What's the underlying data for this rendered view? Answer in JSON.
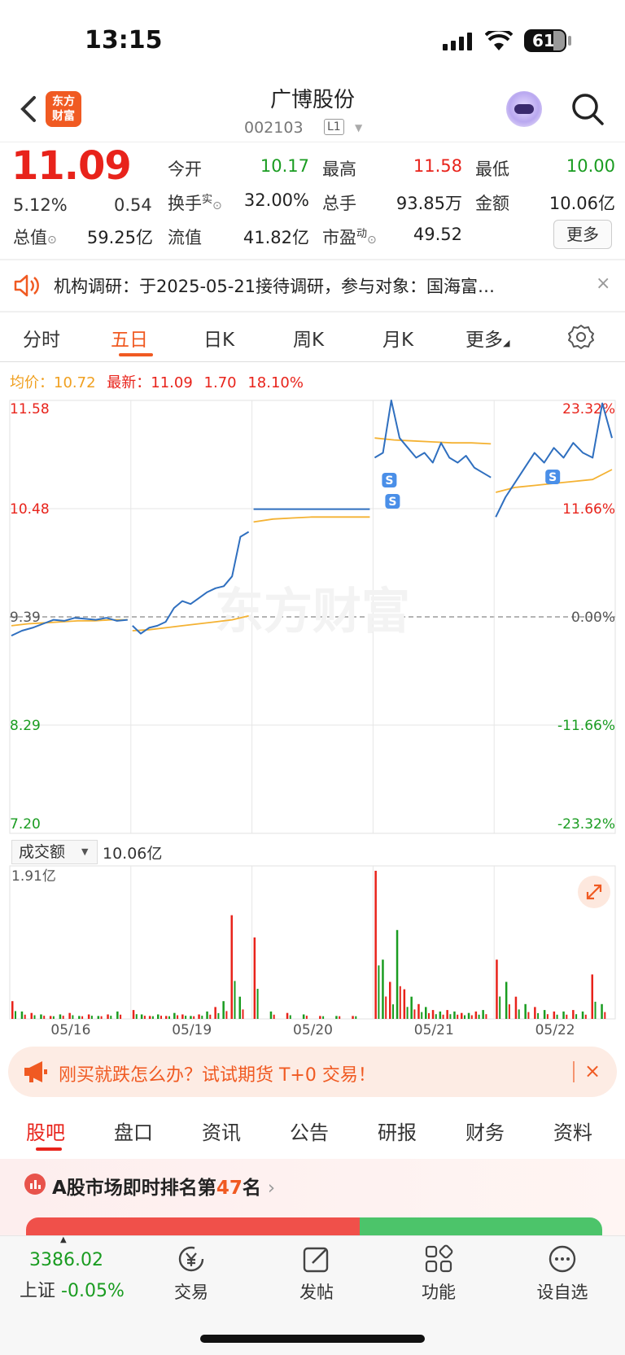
{
  "status_bar": {
    "time": "13:15",
    "battery": "61"
  },
  "header": {
    "title": "广博股份",
    "code": "002103",
    "level": "L1",
    "logo_text_1": "东方",
    "logo_text_2": "财富"
  },
  "quote": {
    "price": "11.09",
    "change_pct": "5.12%",
    "change": "0.54",
    "fields": [
      {
        "label": "今开",
        "value": "10.17",
        "color": "green"
      },
      {
        "label": "最高",
        "value": "11.58",
        "color": "red"
      },
      {
        "label": "最低",
        "value": "10.00",
        "color": "green"
      },
      {
        "label": "换手",
        "sup": "实",
        "value": "32.00%"
      },
      {
        "label": "总手",
        "value": "93.85万"
      },
      {
        "label": "金额",
        "value": "10.06亿"
      },
      {
        "label": "总值",
        "value": "59.25亿"
      },
      {
        "label": "流值",
        "value": "41.82亿"
      },
      {
        "label": "市盈",
        "sup": "动",
        "value": "49.52"
      }
    ],
    "more_label": "更多"
  },
  "notice": {
    "text": "机构调研：于2025-05-21接待调研，参与对象：国海富…",
    "close": "×"
  },
  "chart_tabs": [
    "分时",
    "五日",
    "日K",
    "周K",
    "月K",
    "更多"
  ],
  "avg_info": {
    "avg_label": "均价：",
    "avg_value": "10.72",
    "latest_label": "最新：",
    "latest_value": "11.09",
    "chg": "1.70",
    "chg_pct": "18.10%"
  },
  "chart_data": {
    "type": "line",
    "ylabels_left": [
      "11.58",
      "10.48",
      "9.39",
      "8.29",
      "7.20"
    ],
    "ylabels_right": [
      "23.32%",
      "11.66%",
      "0.00%",
      "-11.66%",
      "-23.32%"
    ],
    "ylim": [
      7.2,
      11.58
    ],
    "days": [
      "05/16",
      "05/19",
      "05/20",
      "05/21",
      "05/22"
    ],
    "series": [
      {
        "name": "最新",
        "color": "#2f6fbf",
        "days": [
          [
            9.2,
            9.25,
            9.28,
            9.32,
            9.36,
            9.35,
            9.38,
            9.37,
            9.36,
            9.38,
            9.35,
            9.36
          ],
          [
            9.3,
            9.22,
            9.28,
            9.3,
            9.34,
            9.48,
            9.55,
            9.52,
            9.58,
            9.64,
            9.68,
            9.7,
            9.8,
            10.2,
            10.25
          ],
          [
            10.48,
            10.48,
            10.48,
            10.48,
            10.48,
            10.48,
            10.48
          ],
          [
            11.0,
            11.05,
            11.58,
            11.2,
            11.1,
            11.0,
            11.05,
            10.95,
            11.15,
            11.0,
            10.95,
            11.02,
            10.9,
            10.85,
            10.8
          ],
          [
            10.4,
            10.6,
            10.75,
            10.9,
            11.05,
            10.95,
            11.1,
            11.0,
            11.15,
            11.05,
            11.0,
            11.55,
            11.2
          ]
        ]
      },
      {
        "name": "均价",
        "color": "#f4b233",
        "days": [
          [
            9.3,
            9.32,
            9.33,
            9.34,
            9.35,
            9.35,
            9.36,
            9.36
          ],
          [
            9.25,
            9.26,
            9.28,
            9.3,
            9.32,
            9.34,
            9.36,
            9.4
          ],
          [
            10.35,
            10.38,
            10.39,
            10.4,
            10.4,
            10.4,
            10.4
          ],
          [
            11.2,
            11.18,
            11.17,
            11.16,
            11.15,
            11.15,
            11.14
          ],
          [
            10.65,
            10.7,
            10.72,
            10.74,
            10.76,
            10.78,
            10.88
          ]
        ]
      }
    ],
    "markers": [
      "S",
      "S",
      "S"
    ],
    "watermark": "东方财富"
  },
  "volume": {
    "select_label": "成交额",
    "total": "10.06亿",
    "max_label": "1.91亿",
    "bars": [
      [
        0.12,
        0.05,
        0.04,
        0.03,
        0.02,
        0.03,
        0.04,
        0.02,
        0.03,
        0.02,
        0.03,
        0.05
      ],
      [
        0.06,
        0.03,
        0.02,
        0.03,
        0.02,
        0.04,
        0.03,
        0.02,
        0.03,
        0.05,
        0.08,
        0.12,
        0.7,
        0.15
      ],
      [
        0.55,
        0.05,
        0.04,
        0.03,
        0.02,
        0.02,
        0.02
      ],
      [
        1.0,
        0.4,
        0.25,
        0.6,
        0.2,
        0.15,
        0.1,
        0.08,
        0.06,
        0.05,
        0.06,
        0.05,
        0.04,
        0.04,
        0.05,
        0.06
      ],
      [
        0.4,
        0.25,
        0.15,
        0.1,
        0.08,
        0.06,
        0.05,
        0.05,
        0.06,
        0.05,
        0.3,
        0.1
      ]
    ]
  },
  "promo": {
    "text": "刚买就跌怎么办？试试期货 T+0 交易！",
    "close": "×"
  },
  "bottom_tabs": [
    "股吧",
    "盘口",
    "资讯",
    "公告",
    "研报",
    "财务",
    "资料"
  ],
  "rank": {
    "prefix": "A股市场即时排名第",
    "rank": "47",
    "suffix": "名"
  },
  "nav": {
    "index_value": "3386.02",
    "index_name": "上证",
    "index_change": "-0.05%",
    "items": [
      "交易",
      "发帖",
      "功能",
      "设自选"
    ]
  }
}
